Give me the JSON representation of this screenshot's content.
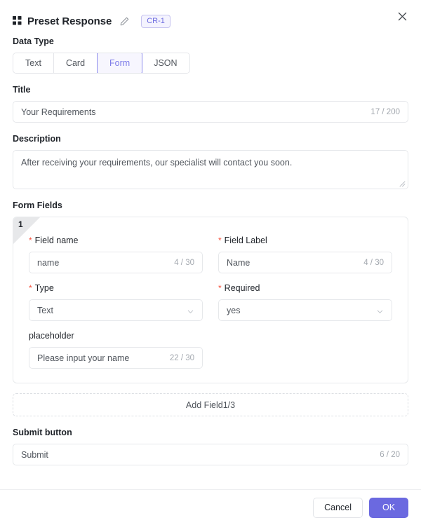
{
  "header": {
    "icon": "grid-apps-icon",
    "title": "Preset Response",
    "edit_icon": "pencil-edit-icon",
    "badge": "CR-1",
    "close_icon": "close-icon",
    "accent_color": "#6b69e0",
    "badge_bg": "#f4f3fe",
    "badge_border": "#c5c2f0"
  },
  "data_type": {
    "label": "Data Type",
    "tabs": [
      {
        "label": "Text",
        "active": false
      },
      {
        "label": "Card",
        "active": false
      },
      {
        "label": "Form",
        "active": true
      },
      {
        "label": "JSON",
        "active": false
      }
    ]
  },
  "title_section": {
    "label": "Title",
    "value": "Your Requirements",
    "counter": "17 / 200"
  },
  "description_section": {
    "label": "Description",
    "value": "After receiving your requirements, our specialist will contact you soon.",
    "resize_icon": "resize-handle-icon"
  },
  "form_fields": {
    "label": "Form Fields",
    "cards": [
      {
        "number": "1",
        "field_name": {
          "label": "Field name",
          "required": true,
          "value": "name",
          "counter": "4 / 30"
        },
        "field_label": {
          "label": "Field Label",
          "required": true,
          "value": "Name",
          "counter": "4 / 30"
        },
        "type": {
          "label": "Type",
          "required": true,
          "value": "Text",
          "icon": "chevron-down-icon"
        },
        "required_select": {
          "label": "Required",
          "required": true,
          "value": "yes",
          "icon": "chevron-down-icon"
        },
        "placeholder": {
          "label": "placeholder",
          "required": false,
          "value": "Please input your name",
          "counter": "22 / 30"
        }
      }
    ],
    "add_field_label": "Add Field1/3"
  },
  "submit_section": {
    "label": "Submit button",
    "value": "Submit",
    "counter": "6 / 20"
  },
  "footer": {
    "cancel_label": "Cancel",
    "ok_label": "OK"
  }
}
